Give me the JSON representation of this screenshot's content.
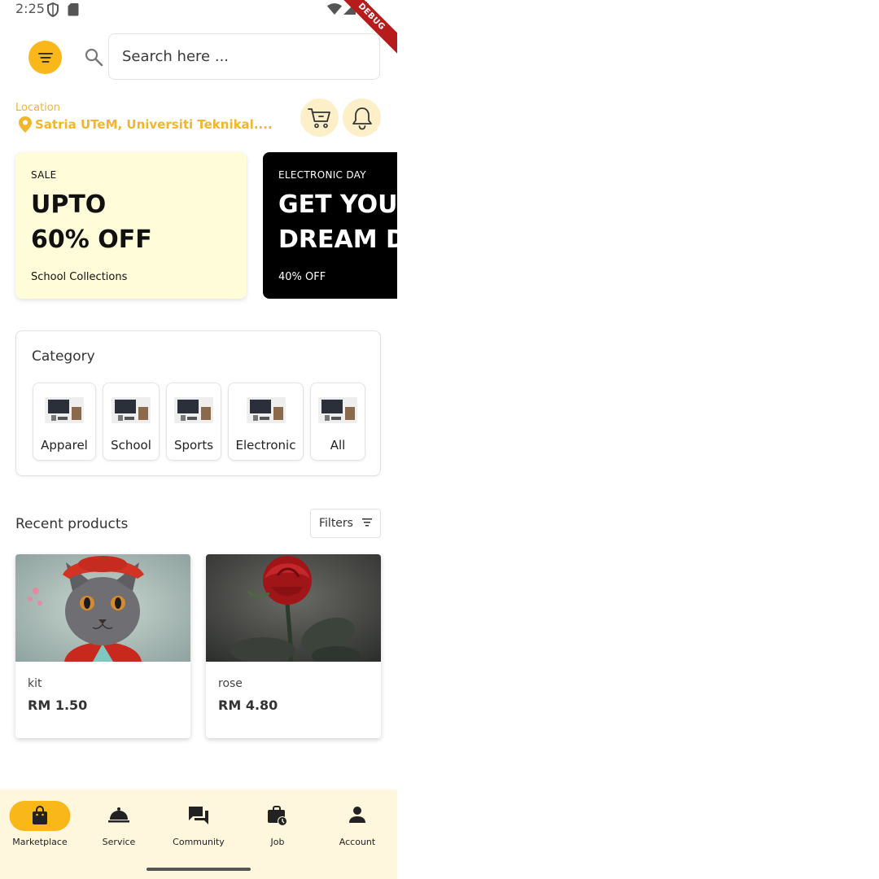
{
  "status_bar": {
    "time": "2:25",
    "debug_label": "DEBUG"
  },
  "header": {
    "search_placeholder": "Search here ...",
    "location_label": "Location",
    "location_value": "Satria UTeM, Universiti Teknikal...."
  },
  "banners": [
    {
      "kicker": "SALE",
      "headline_1": "UPTO",
      "headline_2": "60% OFF",
      "sub": "School Collections"
    },
    {
      "kicker": "ELECTRONIC DAY",
      "headline_1": "GET YOUR",
      "headline_2": "DREAM DE",
      "sub": "40% OFF"
    }
  ],
  "category": {
    "title": "Category",
    "items": [
      {
        "label": "Apparel"
      },
      {
        "label": "School"
      },
      {
        "label": "Sports"
      },
      {
        "label": "Electronic"
      },
      {
        "label": "All"
      }
    ]
  },
  "recent": {
    "title": "Recent products",
    "filters_label": "Filters",
    "products": [
      {
        "name": "kit",
        "price": "RM 1.50"
      },
      {
        "name": "rose",
        "price": "RM 4.80"
      }
    ]
  },
  "bottom_nav": {
    "items": [
      {
        "label": "Marketplace",
        "icon": "shopping-bag-icon",
        "active": true
      },
      {
        "label": "Service",
        "icon": "room-service-icon",
        "active": false
      },
      {
        "label": "Community",
        "icon": "forum-icon",
        "active": false
      },
      {
        "label": "Job",
        "icon": "work-history-icon",
        "active": false
      },
      {
        "label": "Account",
        "icon": "person-icon",
        "active": false
      }
    ]
  },
  "colors": {
    "accent": "#f9b719",
    "location": "#f3b52c",
    "nav_bg": "#fef7de",
    "sale_bg": "#fefcd9",
    "icon_circle_bg": "#fdefc8"
  }
}
